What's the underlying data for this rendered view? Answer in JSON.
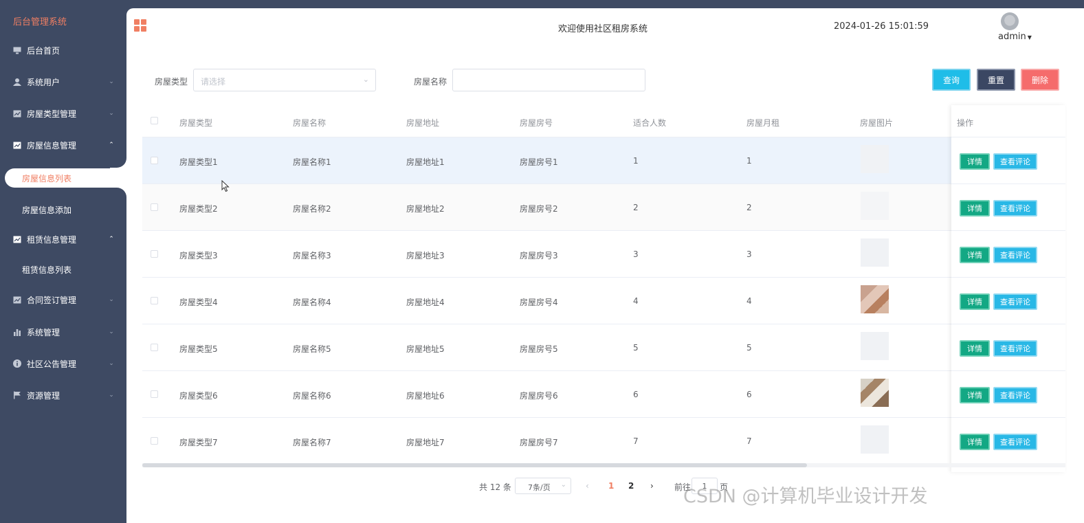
{
  "sidebar": {
    "brand": "后台管理系统",
    "items": [
      {
        "label": "后台首页",
        "icon": "monitor-icon"
      },
      {
        "label": "系统用户",
        "icon": "user-icon"
      },
      {
        "label": "房屋类型管理",
        "icon": "chart-icon"
      },
      {
        "label": "房屋信息管理",
        "icon": "chart-icon"
      },
      {
        "label": "租赁信息管理",
        "icon": "chart-icon"
      },
      {
        "label": "合同签订管理",
        "icon": "chart-icon"
      },
      {
        "label": "系统管理",
        "icon": "bar-chart-icon"
      },
      {
        "label": "社区公告管理",
        "icon": "info-icon"
      },
      {
        "label": "资源管理",
        "icon": "flag-icon"
      }
    ],
    "sub_house": [
      "房屋信息列表",
      "房屋信息添加"
    ],
    "sub_rent": [
      "租赁信息列表"
    ]
  },
  "header": {
    "welcome": "欢迎使用社区租房系统",
    "datetime": "2024-01-26 15:01:59",
    "user": "admin"
  },
  "filters": {
    "type_label": "房屋类型",
    "type_placeholder": "请选择",
    "name_label": "房屋名称",
    "query": "查询",
    "reset": "重置",
    "delete": "删除"
  },
  "table": {
    "columns": [
      "房屋类型",
      "房屋名称",
      "房屋地址",
      "房屋房号",
      "适合人数",
      "房屋月租",
      "房屋图片",
      "操作"
    ],
    "rows": [
      {
        "type": "房屋类型1",
        "name": "房屋名称1",
        "addr": "房屋地址1",
        "no": "房屋房号1",
        "people": "1",
        "rent": "1"
      },
      {
        "type": "房屋类型2",
        "name": "房屋名称2",
        "addr": "房屋地址2",
        "no": "房屋房号2",
        "people": "2",
        "rent": "2"
      },
      {
        "type": "房屋类型3",
        "name": "房屋名称3",
        "addr": "房屋地址3",
        "no": "房屋房号3",
        "people": "3",
        "rent": "3"
      },
      {
        "type": "房屋类型4",
        "name": "房屋名称4",
        "addr": "房屋地址4",
        "no": "房屋房号4",
        "people": "4",
        "rent": "4"
      },
      {
        "type": "房屋类型5",
        "name": "房屋名称5",
        "addr": "房屋地址5",
        "no": "房屋房号5",
        "people": "5",
        "rent": "5"
      },
      {
        "type": "房屋类型6",
        "name": "房屋名称6",
        "addr": "房屋地址6",
        "no": "房屋房号6",
        "people": "6",
        "rent": "6"
      },
      {
        "type": "房屋类型7",
        "name": "房屋名称7",
        "addr": "房屋地址7",
        "no": "房屋房号7",
        "people": "7",
        "rent": "7"
      }
    ],
    "detail_label": "详情",
    "comment_label": "查看评论"
  },
  "pagination": {
    "total": "共 12 条",
    "page_size": "7条/页",
    "pages": [
      "1",
      "2"
    ],
    "goto_prefix": "前往",
    "goto_value": "1",
    "goto_suffix": "页"
  },
  "watermark": "CSDN @计算机毕业设计开发",
  "colors": {
    "accent": "#f07f63",
    "sidebar": "#3e4a63",
    "query": "#1fbde8",
    "delete": "#f56c6c",
    "detail": "#13a884"
  }
}
